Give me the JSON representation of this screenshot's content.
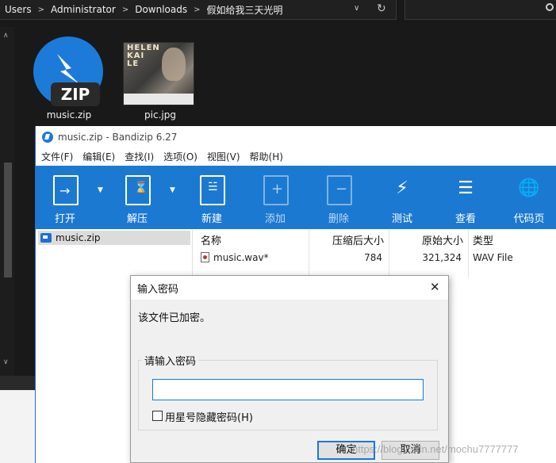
{
  "explorer": {
    "breadcrumbs": [
      "Users",
      "Administrator",
      "Downloads",
      "假如给我三天光明"
    ],
    "separator": ">",
    "files": [
      {
        "name": "music.zip",
        "icon": "bandizip-zip-icon",
        "badge": "ZIP"
      },
      {
        "name": "pic.jpg",
        "icon": "image-thumbnail"
      }
    ],
    "pic_thumb_text": "HELEN\nKAI\nLE"
  },
  "bandizip": {
    "title": "music.zip - Bandizip 6.27",
    "menu": [
      "文件(F)",
      "编辑(E)",
      "查找(I)",
      "选项(O)",
      "视图(V)",
      "帮助(H)"
    ],
    "toolbar": [
      {
        "label": "打开",
        "icon": "open-icon",
        "enabled": true,
        "dropdown": true
      },
      {
        "label": "解压",
        "icon": "extract-icon",
        "enabled": true,
        "dropdown": true
      },
      {
        "label": "新建",
        "icon": "new-archive-icon",
        "enabled": true
      },
      {
        "label": "添加",
        "icon": "add-icon",
        "enabled": false
      },
      {
        "label": "删除",
        "icon": "delete-icon",
        "enabled": false
      },
      {
        "label": "测试",
        "icon": "test-icon",
        "enabled": true
      },
      {
        "label": "查看",
        "icon": "view-icon",
        "enabled": true
      },
      {
        "label": "代码页",
        "icon": "codepage-icon",
        "enabled": true
      }
    ],
    "tree_item": "music.zip",
    "columns": [
      "名称",
      "压缩后大小",
      "原始大小",
      "类型"
    ],
    "rows": [
      {
        "name": "music.wav*",
        "compressed": "784",
        "original": "321,324",
        "type": "WAV File"
      }
    ],
    "colors": {
      "toolbar": "#1c79d1",
      "accent": "#1b78d4"
    }
  },
  "dialog": {
    "title": "输入密码",
    "message": "该文件已加密。",
    "group_title": "请输入密码",
    "password_value": "",
    "checkbox_label": "用星号隐藏密码(H)",
    "checkbox_checked": false,
    "ok_label": "确定",
    "cancel_label": "取消"
  },
  "watermark": "https://blog.csdn.net/mochu7777777"
}
